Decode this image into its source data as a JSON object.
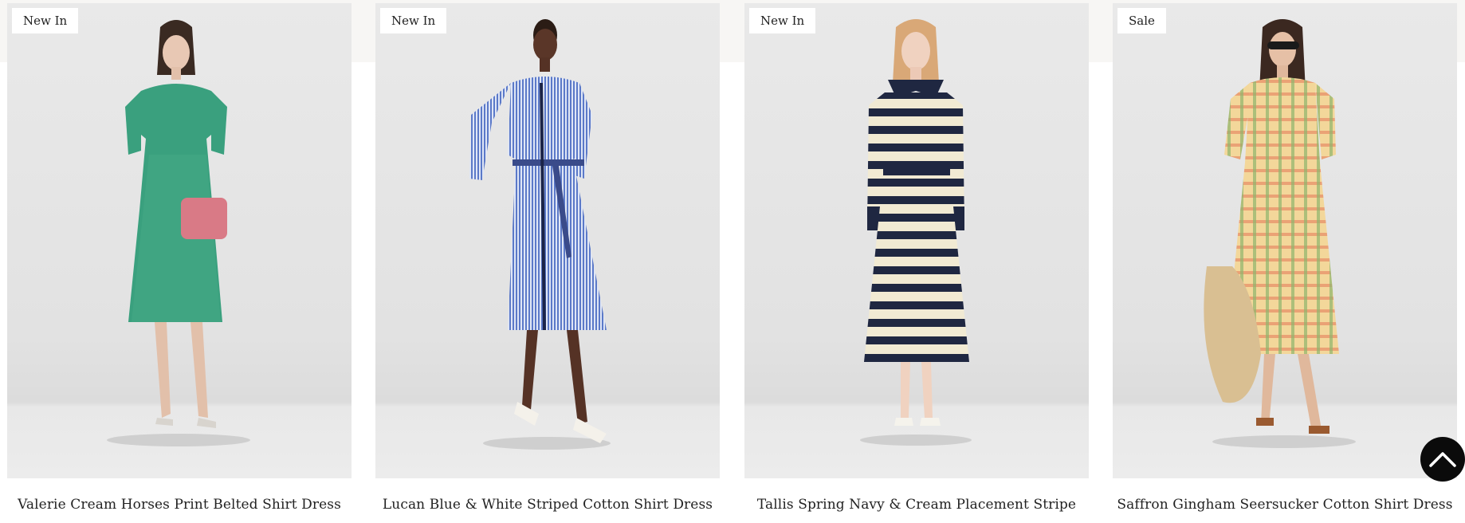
{
  "products": [
    {
      "badge": "New In",
      "title": "Valerie Cream Horses Print Belted Shirt Dress",
      "image_icon": "model-in-green-print-shirt-dress-photo"
    },
    {
      "badge": "New In",
      "title": "Lucan Blue & White Striped Cotton Shirt Dress",
      "image_icon": "model-in-blue-striped-shirt-dress-photo"
    },
    {
      "badge": "New In",
      "title": "Tallis Spring Navy & Cream Placement Stripe",
      "image_icon": "model-in-navy-cream-striped-dress-photo"
    },
    {
      "badge": "Sale",
      "title": "Saffron Gingham Seersucker Cotton Shirt Dress",
      "image_icon": "model-in-yellow-gingham-shirt-dress-photo"
    }
  ],
  "scroll_top": {
    "icon": "chevron-up-icon"
  },
  "colors": {
    "badge_bg": "#ffffff",
    "page_bg": "#ffffff",
    "top_band": "#f7f6f4",
    "scroll_button": "#0b0b0b"
  }
}
